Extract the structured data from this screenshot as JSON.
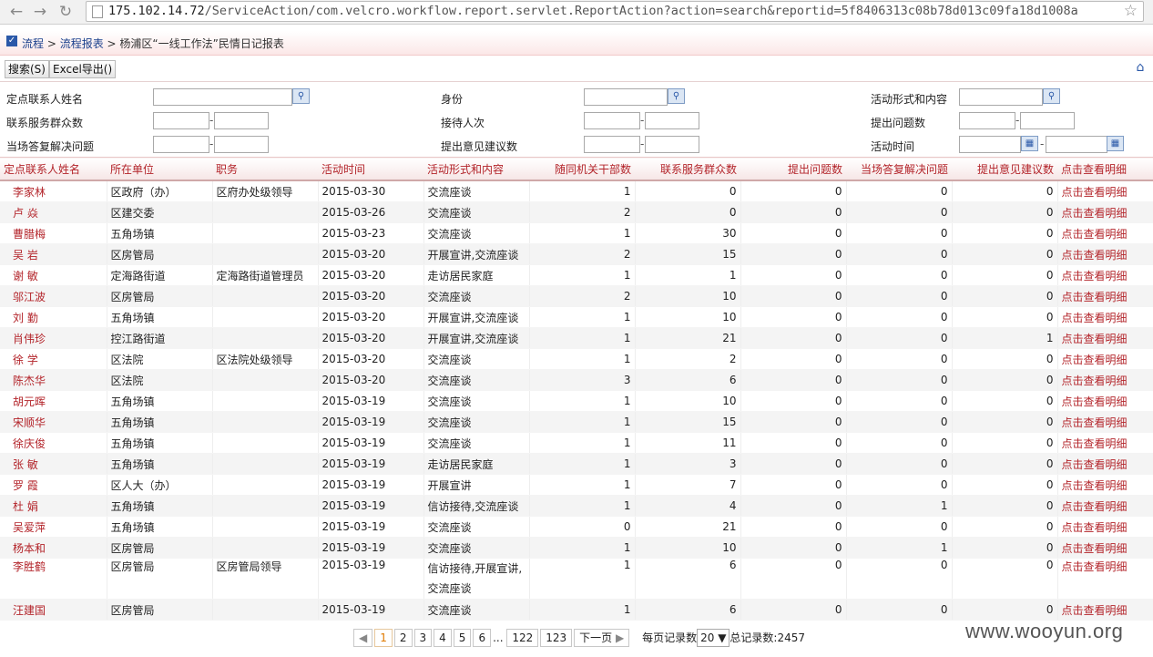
{
  "browser": {
    "url_host": "175.102.14.72",
    "url_path": "/ServiceAction/com.velcro.workflow.report.servlet.ReportAction?action=search&reportid=5f8406313c08b78d013c09fa18d1008a"
  },
  "breadcrumb": {
    "root": "流程",
    "sep1": " > ",
    "level1": "流程报表",
    "sep2": " > ",
    "current": "杨浦区“一线工作法”民情日记报表"
  },
  "toolbar": {
    "search_label": "搜索(S)",
    "excel_label": "Excel导出()"
  },
  "filters": {
    "contact_name": "定点联系人姓名",
    "identity": "身份",
    "activity_form": "活动形式和内容",
    "service_count": "联系服务群众数",
    "reception_count": "接待人次",
    "issue_count": "提出问题数",
    "solved_count": "当场答复解决问题",
    "suggestion_count": "提出意见建议数",
    "activity_time": "活动时间",
    "dash": "-"
  },
  "table": {
    "headers": [
      "定点联系人姓名",
      "所在单位",
      "职务",
      "活动时间",
      "活动形式和内容",
      "随同机关干部数",
      "联系服务群众数",
      "提出问题数",
      "当场答复解决问题",
      "提出意见建议数",
      "点击查看明细"
    ],
    "rows": [
      [
        "李家林",
        "区政府（办）",
        "区府办处级领导",
        "2015-03-30",
        "交流座谈",
        "1",
        "0",
        "0",
        "0",
        "0",
        "点击查看明细"
      ],
      [
        "卢 焱",
        "区建交委",
        "",
        "2015-03-26",
        "交流座谈",
        "2",
        "0",
        "0",
        "0",
        "0",
        "点击查看明细"
      ],
      [
        "曹腊梅",
        "五角场镇",
        "",
        "2015-03-23",
        "交流座谈",
        "1",
        "30",
        "0",
        "0",
        "0",
        "点击查看明细"
      ],
      [
        "吴 岩",
        "区房管局",
        "",
        "2015-03-20",
        "开展宣讲,交流座谈",
        "2",
        "15",
        "0",
        "0",
        "0",
        "点击查看明细"
      ],
      [
        "谢 敏",
        "定海路街道",
        "定海路街道管理员",
        "2015-03-20",
        "走访居民家庭",
        "1",
        "1",
        "0",
        "0",
        "0",
        "点击查看明细"
      ],
      [
        "邬江波",
        "区房管局",
        "",
        "2015-03-20",
        "交流座谈",
        "2",
        "10",
        "0",
        "0",
        "0",
        "点击查看明细"
      ],
      [
        "刘 勤",
        "五角场镇",
        "",
        "2015-03-20",
        "开展宣讲,交流座谈",
        "1",
        "10",
        "0",
        "0",
        "0",
        "点击查看明细"
      ],
      [
        "肖伟珍",
        "控江路街道",
        "",
        "2015-03-20",
        "开展宣讲,交流座谈",
        "1",
        "21",
        "0",
        "0",
        "1",
        "点击查看明细"
      ],
      [
        "徐 学",
        "区法院",
        "区法院处级领导",
        "2015-03-20",
        "交流座谈",
        "1",
        "2",
        "0",
        "0",
        "0",
        "点击查看明细"
      ],
      [
        "陈杰华",
        "区法院",
        "",
        "2015-03-20",
        "交流座谈",
        "3",
        "6",
        "0",
        "0",
        "0",
        "点击查看明细"
      ],
      [
        "胡元晖",
        "五角场镇",
        "",
        "2015-03-19",
        "交流座谈",
        "1",
        "10",
        "0",
        "0",
        "0",
        "点击查看明细"
      ],
      [
        "宋顺华",
        "五角场镇",
        "",
        "2015-03-19",
        "交流座谈",
        "1",
        "15",
        "0",
        "0",
        "0",
        "点击查看明细"
      ],
      [
        "徐庆俊",
        "五角场镇",
        "",
        "2015-03-19",
        "交流座谈",
        "1",
        "11",
        "0",
        "0",
        "0",
        "点击查看明细"
      ],
      [
        "张 敏",
        "五角场镇",
        "",
        "2015-03-19",
        "走访居民家庭",
        "1",
        "3",
        "0",
        "0",
        "0",
        "点击查看明细"
      ],
      [
        "罗 霞",
        "区人大（办）",
        "",
        "2015-03-19",
        "开展宣讲",
        "1",
        "7",
        "0",
        "0",
        "0",
        "点击查看明细"
      ],
      [
        "杜 娟",
        "五角场镇",
        "",
        "2015-03-19",
        "信访接待,交流座谈",
        "1",
        "4",
        "0",
        "1",
        "0",
        "点击查看明细"
      ],
      [
        "吴爱萍",
        "五角场镇",
        "",
        "2015-03-19",
        "交流座谈",
        "0",
        "21",
        "0",
        "0",
        "0",
        "点击查看明细"
      ],
      [
        "杨本和",
        "区房管局",
        "",
        "2015-03-19",
        "交流座谈",
        "1",
        "10",
        "0",
        "1",
        "0",
        "点击查看明细"
      ],
      [
        "李胜鹤",
        "区房管局",
        "区房管局领导",
        "2015-03-19",
        "信访接待,开展宣讲,交流座谈",
        "1",
        "6",
        "0",
        "0",
        "0",
        "点击查看明细"
      ],
      [
        "汪建国",
        "区房管局",
        "",
        "2015-03-19",
        "交流座谈",
        "1",
        "6",
        "0",
        "0",
        "0",
        "点击查看明细"
      ]
    ]
  },
  "pager": {
    "pages": [
      "1",
      "2",
      "3",
      "4",
      "5",
      "6"
    ],
    "ellipsis": "...",
    "p122": "122",
    "p123": "123",
    "next": "下一页",
    "per_page_label": "每页记录数",
    "per_page_value": "20",
    "total_label": "总记录数:2457"
  },
  "watermark": "www.wooyun.org"
}
